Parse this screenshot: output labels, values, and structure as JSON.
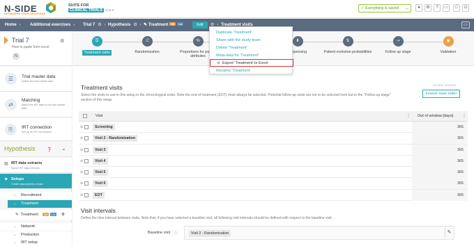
{
  "header": {
    "logo": "N-SIDE",
    "logo_tagline": "OPTIMIZING YOUR DECISIONS",
    "suite_line1": "SUITE FOR",
    "suite_line2": "CLINICAL TRIALS",
    "version": "v4.6.0",
    "save_status": "Everything is saved",
    "icons": [
      "record-icon",
      "gear-icon",
      "help-icon",
      "chat-icon",
      "user-icon",
      "power-icon"
    ],
    "icon_glyphs": [
      "●",
      "⚙",
      "?",
      "▭",
      "⚇",
      "⏻"
    ]
  },
  "breadcrumb": {
    "home": "Home",
    "additional": "Additional exercises",
    "trial": "Trial 7",
    "hypothesis": "Hypothesis",
    "treatment": "Treatment",
    "badge1": "SE",
    "badge2": "LA",
    "edit_label": "Edit",
    "current": "Treatment visits"
  },
  "sidebar": {
    "trial_title": "Trial 7",
    "trial_sub": "How to paste from excel",
    "avatar": "N",
    "cards": [
      {
        "title": "Trial master data",
        "subtitle": "Define the trial master data",
        "icon": "database-icon",
        "glyph": "☰"
      },
      {
        "title": "Matching",
        "subtitle": "Match the IRT data to the trial master data",
        "icon": "matching-icon",
        "glyph": "⇄"
      },
      {
        "title": "IRT connection",
        "subtitle": "Set up an IRT connection",
        "icon": "connection-icon",
        "glyph": "⎘"
      }
    ],
    "hypothesis_title": "Hypothesis",
    "irt_title": "IRT data extracts",
    "irt_sub": "Import IRT data extracts",
    "setups_title": "Setups",
    "setups_sub": "Create assumptions setups",
    "sub_items": [
      "Recruitment",
      "Treatment",
      "Network",
      "Production",
      "IRT setup"
    ],
    "treatment_child": "Treatment",
    "treatment_child_b1": "SE",
    "treatment_child_b2": "LA"
  },
  "steps": [
    {
      "label": "Treatment visits",
      "icon": "list-icon",
      "glyph": "☰",
      "state": "active"
    },
    {
      "label": "Randomization",
      "icon": "shuffle-icon",
      "glyph": "⤮",
      "state": "normal"
    },
    {
      "label": "Proportions for patient attributes",
      "icon": "percent-icon",
      "glyph": "%",
      "state": "normal"
    },
    {
      "label": "Dispensing",
      "icon": "dispense-icon",
      "glyph": "⬇",
      "state": "normal"
    },
    {
      "label": "Patient evolution probabilities",
      "icon": "evolution-icon",
      "glyph": "⇅",
      "state": "normal"
    },
    {
      "label": "Follow up stage",
      "icon": "follow-icon",
      "glyph": "⇢",
      "state": "normal"
    },
    {
      "label": "Validation",
      "icon": "validation-icon",
      "glyph": "◉",
      "state": "done"
    }
  ],
  "menu": {
    "items": [
      "Duplicate 'Treatment'",
      "Share with the study team",
      "Delete 'Treatment'",
      "Meta-data for 'Treatment'",
      "Export 'Treatment' to Excel",
      "Rename 'Treatment'"
    ]
  },
  "visits": {
    "title": "Treatment visits",
    "description": "Select the visits to use in this setup in the chronological order. Note the end of treatment (EOT) must always be selected. Potential follow-up visits are not to be selected here but in the \"Follow-up stage\" section of this setup.",
    "no_item": "No item selected",
    "freeze_label": "Freeze rows order",
    "col_visit": "Visit",
    "col_window": "Out of window [days]",
    "rows": [
      {
        "name": "Screening",
        "window": "365"
      },
      {
        "name": "Visit 2 - Randomization",
        "window": "365"
      },
      {
        "name": "Visit 3",
        "window": "365"
      },
      {
        "name": "Visit 4",
        "window": "365"
      },
      {
        "name": "Visit 5",
        "window": "365"
      },
      {
        "name": "Visit 6",
        "window": "365"
      },
      {
        "name": "EOT",
        "window": "365"
      }
    ]
  },
  "intervals": {
    "title": "Visit intervals",
    "description": "Define the time interval between visits. Note that, if you have selected a baseline visit, all following visit intervals should be defined with respect to the baseline visit.",
    "baseline_label": "Baseline visit",
    "baseline_value": "Visit 2 - Randomization"
  },
  "colors": {
    "accent": "#2aa6b5",
    "nav": "#5b6b80",
    "hypothesis": "#8aa42a",
    "saved": "#6b9a1f",
    "highlight_border": "#e03131"
  }
}
